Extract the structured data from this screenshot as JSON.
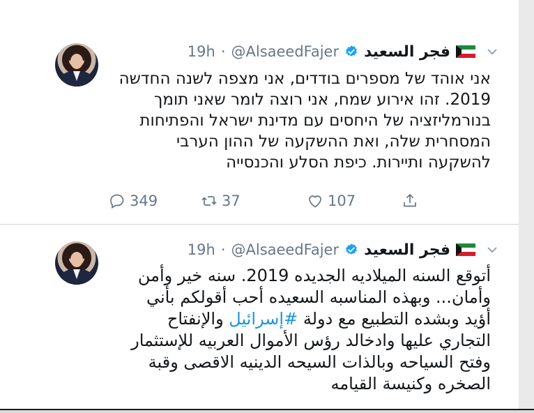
{
  "tweets": [
    {
      "name": "فجر السعيد",
      "handle": "@AlsaeedFajer",
      "separator": "·",
      "time": "19h",
      "text_lines": [
        "אני אוהד של מספרים בודדים, אני מצפה לשנה החדשה",
        "2019. זהו אירוע שמח, אני רוצה לומר שאני תומך",
        "בנורמליזציה של היחסים עם מדינת ישראל והפתיחות",
        "המסחרית שלה, ואת ההשקעה של ההון הערבי",
        "להשקעה ותיירות. כיפת הסלע והכנסייה"
      ],
      "counts": {
        "replies": "349",
        "retweets": "37",
        "likes": "107"
      }
    },
    {
      "name": "فجر السعيد",
      "handle": "@AlsaeedFajer",
      "separator": "·",
      "time": "19h",
      "line1": "أتوقع السنه الميلاديه الجديده 2019. سنه خير وأمن",
      "line2": "وأمان... وبهذه المناسبه السعيده أحب أقولكم بأني",
      "line3_before": "أؤيد وبشده التطبيع مع دولة ",
      "hashtag": "#إسرائيل",
      "line3_after": " والإنفتاح",
      "line4": "التجاري عليها وادخالد رؤس الأموال العربيه للإستثمار",
      "line5": "وفتح السياحه وبالذات السيحه الدينيه الاقصى وقبة",
      "line6": "الصخره وكنيسة القيامه"
    }
  ],
  "icons": {
    "verified": "verified-badge-icon",
    "caret": "chevron-down-icon",
    "reply": "reply-icon",
    "retweet": "retweet-icon",
    "like": "heart-icon",
    "share": "share-icon",
    "flag": "kuwait-flag-icon"
  },
  "colors": {
    "text": "#14171a",
    "meta": "#657786",
    "link": "#1b95e0",
    "verified": "#1da1f2"
  }
}
